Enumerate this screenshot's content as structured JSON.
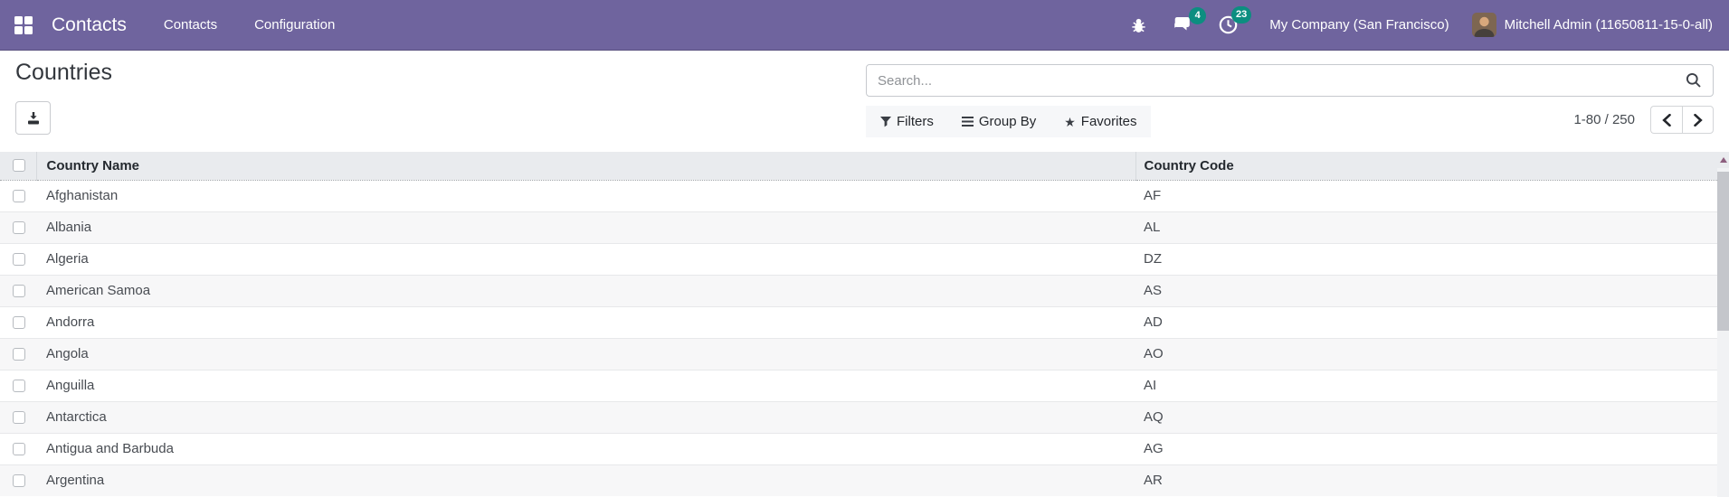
{
  "nav": {
    "brand": "Contacts",
    "menu_items": [
      "Contacts",
      "Configuration"
    ],
    "message_badge": "4",
    "activity_badge": "23",
    "company": "My Company (San Francisco)",
    "user": "Mitchell Admin (11650811-15-0-all)"
  },
  "page": {
    "title": "Countries",
    "search_placeholder": "Search...",
    "filters_label": "Filters",
    "group_by_label": "Group By",
    "favorites_label": "Favorites",
    "pager_text": "1-80 / 250"
  },
  "table": {
    "columns": [
      "Country Name",
      "Country Code"
    ],
    "rows": [
      {
        "name": "Afghanistan",
        "code": "AF"
      },
      {
        "name": "Albania",
        "code": "AL"
      },
      {
        "name": "Algeria",
        "code": "DZ"
      },
      {
        "name": "American Samoa",
        "code": "AS"
      },
      {
        "name": "Andorra",
        "code": "AD"
      },
      {
        "name": "Angola",
        "code": "AO"
      },
      {
        "name": "Anguilla",
        "code": "AI"
      },
      {
        "name": "Antarctica",
        "code": "AQ"
      },
      {
        "name": "Antigua and Barbuda",
        "code": "AG"
      },
      {
        "name": "Argentina",
        "code": "AR"
      }
    ]
  },
  "icons": {
    "apps": "apps-grid-icon",
    "bug": "bug-icon",
    "messages": "chat-bubbles-icon",
    "activities": "clock-icon",
    "search": "magnifier-icon",
    "filters": "funnel-icon",
    "group_by": "bars-icon",
    "favorites": "star-icon",
    "export": "download-icon",
    "pager_prev": "chevron-left-icon",
    "pager_next": "chevron-right-icon"
  },
  "colors": {
    "navbar": "#6F649E",
    "badge_teal": "#0C8E80",
    "table_header_bg": "#E9EBEE"
  }
}
